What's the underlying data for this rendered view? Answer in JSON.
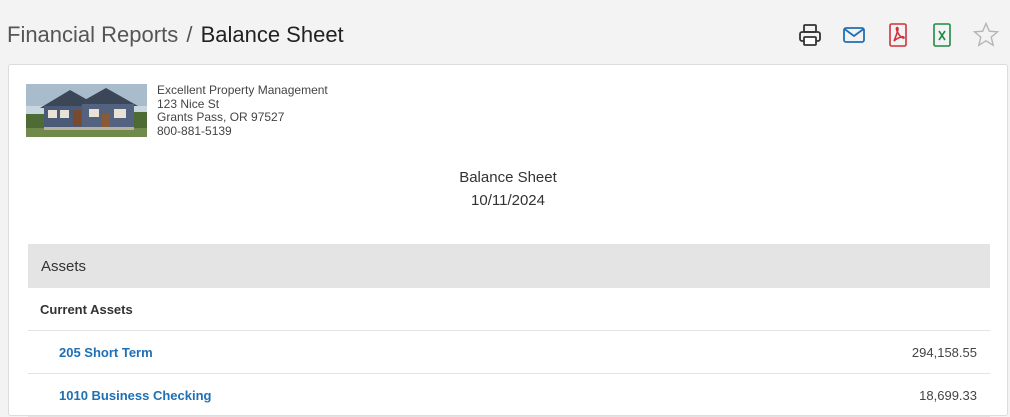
{
  "header": {
    "breadcrumb_parent": "Financial Reports",
    "breadcrumb_separator": "/",
    "breadcrumb_current": "Balance Sheet"
  },
  "toolbar": {
    "icons": [
      "printer-icon",
      "email-icon",
      "pdf-icon",
      "excel-icon",
      "star-icon"
    ],
    "colors": {
      "printer": "#333333",
      "email": "#1f6fb4",
      "pdf": "#d0313a",
      "excel": "#1e8b45",
      "star": "#b5b5b5"
    }
  },
  "company": {
    "name": "Excellent Property Management",
    "street": "123 Nice St",
    "city_state_zip": "Grants Pass, OR 97527",
    "phone": "800-881-5139"
  },
  "report": {
    "title": "Balance Sheet",
    "date": "10/11/2024"
  },
  "sections": {
    "assets_label": "Assets",
    "current_assets_label": "Current Assets",
    "accounts": [
      {
        "name": "205 Short Term",
        "amount": "294,158.55"
      },
      {
        "name": "1010 Business Checking",
        "amount": "18,699.33"
      }
    ]
  },
  "colors": {
    "link": "#1f6fb4",
    "section_bg": "#e4e4e5"
  }
}
